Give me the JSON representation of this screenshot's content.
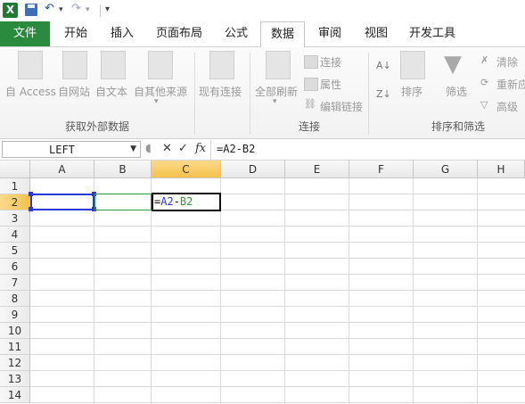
{
  "qat": {
    "app_icon_letter": "X"
  },
  "tabs": [
    {
      "label": "文件"
    },
    {
      "label": "开始"
    },
    {
      "label": "插入"
    },
    {
      "label": "页面布局"
    },
    {
      "label": "公式"
    },
    {
      "label": "数据"
    },
    {
      "label": "审阅"
    },
    {
      "label": "视图"
    },
    {
      "label": "开发工具"
    }
  ],
  "ribbon": {
    "get_external": {
      "label": "获取外部数据",
      "commands": [
        "自 Access",
        "自网站",
        "自文本",
        "自其他来源"
      ]
    },
    "existing_connections": "现有连接",
    "connections": {
      "label": "连接",
      "refresh_all": "全部刷新",
      "connections": "连接",
      "properties": "属性",
      "edit_links": "编辑链接"
    },
    "sort_filter": {
      "label": "排序和筛选",
      "sort": "排序",
      "filter": "筛选",
      "clear": "清除",
      "reapply": "重新应",
      "advanced": "高级"
    }
  },
  "formula_bar": {
    "name_box": "LEFT",
    "cancel_symbol": "✕",
    "enter_symbol": "✓",
    "fx_label": "fx",
    "formula": "=A2-B2"
  },
  "sheet": {
    "columns": [
      "A",
      "B",
      "C",
      "D",
      "E",
      "F",
      "G",
      "H"
    ],
    "rows": [
      "1",
      "2",
      "3",
      "4",
      "5",
      "6",
      "7",
      "8",
      "9",
      "10",
      "11",
      "12",
      "13",
      "14"
    ],
    "active_cell_text": "=A2-B2",
    "ref_a2_color": "#2a3ad8",
    "ref_b2_color": "#2e9a3a"
  }
}
